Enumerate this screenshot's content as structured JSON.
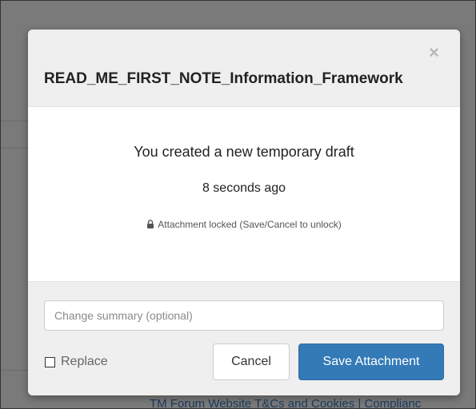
{
  "background": {
    "footer_link": "TM Forum Website T&Cs and Cookies | Complianc"
  },
  "modal": {
    "title": "READ_ME_FIRST_NOTE_Information_Framework",
    "close_symbol": "×",
    "body": {
      "draft_message": "You created a new temporary draft",
      "draft_time": "8 seconds ago",
      "lock_icon": "lock-icon",
      "lock_note": "Attachment locked (Save/Cancel to unlock)"
    },
    "footer": {
      "summary_placeholder": "Change summary (optional)",
      "summary_value": "",
      "replace_label": "Replace",
      "replace_checked": false,
      "cancel_label": "Cancel",
      "save_label": "Save Attachment"
    }
  },
  "colors": {
    "overlay": "#7a7a7a",
    "primary": "#337ab7",
    "header_bg": "#efefef"
  }
}
